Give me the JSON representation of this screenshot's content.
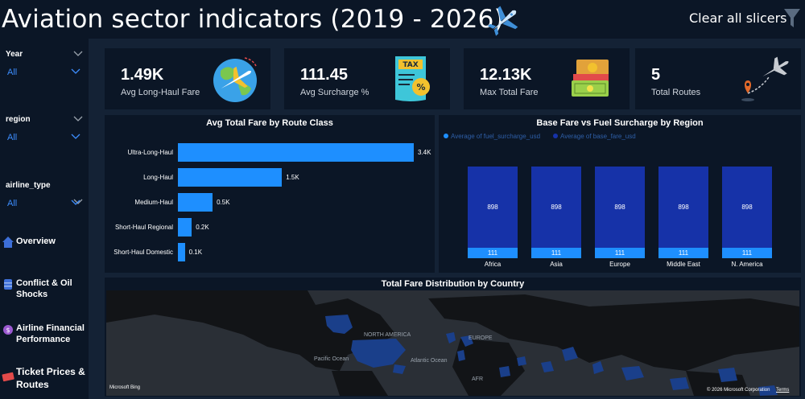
{
  "header": {
    "title": "Aviation sector indicators (2019 - 2026)",
    "clear_label": "Clear all slicers"
  },
  "slicers": [
    {
      "label": "Year",
      "value": "All"
    },
    {
      "label": "region",
      "value": "All"
    },
    {
      "label": "airline_type",
      "value": "All"
    }
  ],
  "nav": [
    {
      "label": "Overview",
      "icon": "home-icon"
    },
    {
      "label": "Conflict & Oil Shocks",
      "icon": "oil-barrel-icon"
    },
    {
      "label": "Airline Financial Performance",
      "icon": "finance-icon"
    },
    {
      "label": "Ticket Prices & Routes",
      "icon": "ticket-icon"
    }
  ],
  "kpis": [
    {
      "value": "1.49K",
      "label": "Avg Long-Haul Fare",
      "icon": "globe-plane-icon"
    },
    {
      "value": "111.45",
      "label": "Avg Surcharge %",
      "icon": "tax-document-icon"
    },
    {
      "value": "12.13K",
      "label": "Max Total Fare",
      "icon": "money-stack-icon"
    },
    {
      "value": "5",
      "label": "Total Routes",
      "icon": "route-plane-icon"
    }
  ],
  "colors": {
    "background": "#0b1626",
    "panel_bg": "#142235",
    "bar": "#1e8fff",
    "base_fare": "#1632a8",
    "fuel_surcharge": "#1e8fff",
    "slicer_value": "#3d8eff"
  },
  "chart_data": [
    {
      "type": "bar",
      "orientation": "horizontal",
      "title": "Avg Total Fare by Route Class",
      "categories": [
        "Ultra-Long-Haul",
        "Long-Haul",
        "Medium-Haul",
        "Short-Haul Regional",
        "Short-Haul Domestic"
      ],
      "values": [
        3400,
        1500,
        500,
        200,
        100
      ],
      "data_labels": [
        "3.4K",
        "1.5K",
        "0.5K",
        "0.2K",
        "0.1K"
      ]
    },
    {
      "type": "bar",
      "stacked": true,
      "title": "Base Fare vs Fuel Surcharge by Region",
      "categories": [
        "Africa",
        "Asia",
        "Europe",
        "Middle East",
        "N. America"
      ],
      "series": [
        {
          "name": "Average of fuel_surcharge_usd",
          "values": [
            111,
            111,
            111,
            111,
            111
          ]
        },
        {
          "name": "Average of base_fare_usd",
          "values": [
            898,
            898,
            898,
            898,
            898
          ]
        }
      ],
      "legend": "top-left"
    }
  ],
  "map": {
    "title": "Total Fare Distribution by Country",
    "labels": [
      "NORTH AMERICA",
      "EUROPE",
      "Pacific Ocean",
      "Atlantic Ocean",
      "AFR"
    ],
    "attribution": "Microsoft Bing",
    "copyright": "© 2026 Microsoft Corporation",
    "terms": "Terms"
  }
}
